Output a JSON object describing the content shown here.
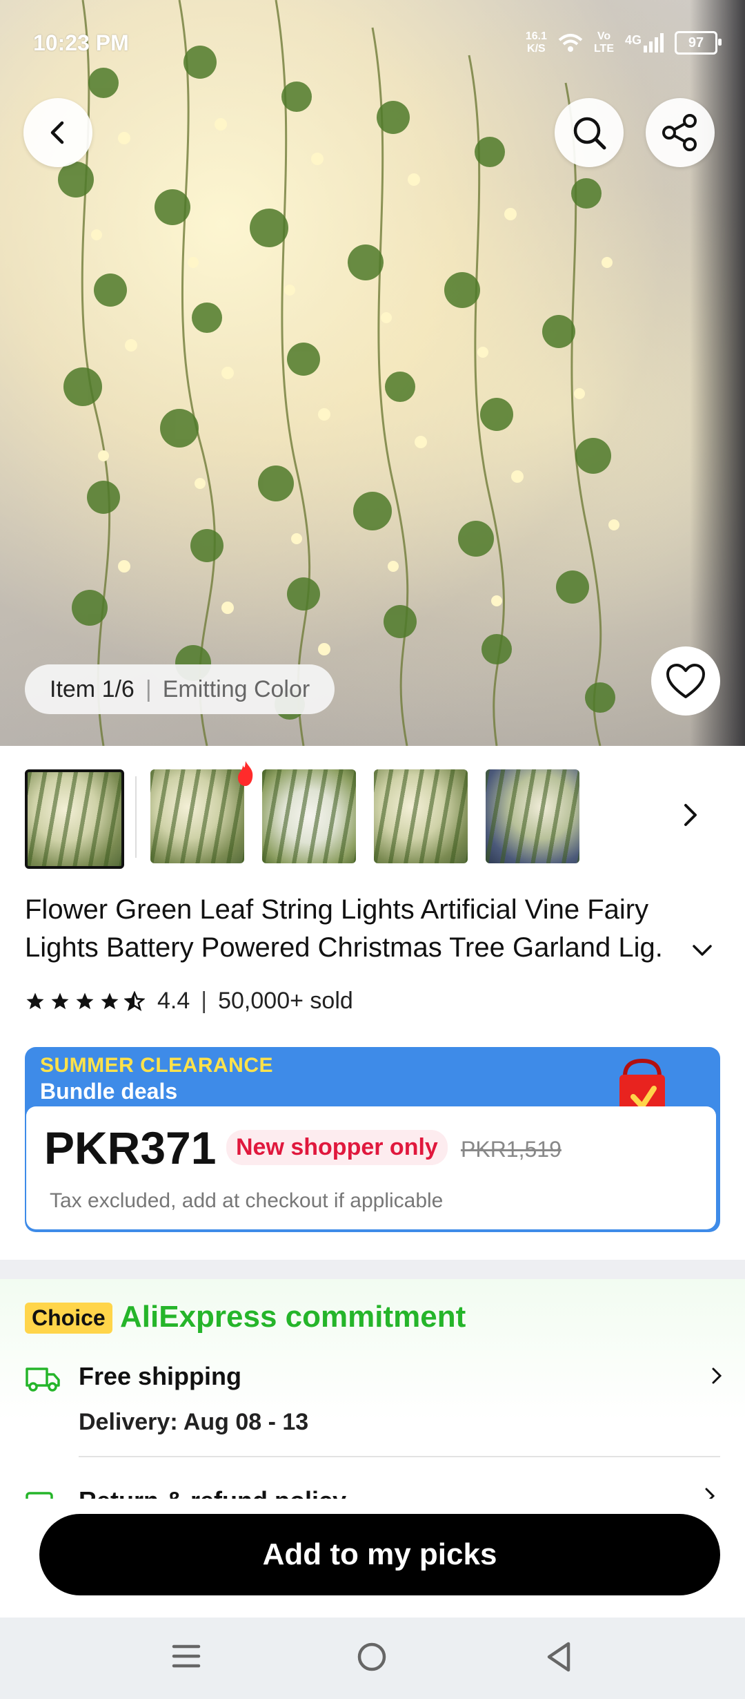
{
  "status_bar": {
    "time": "10:23 PM",
    "net_speed_value": "16.1",
    "net_speed_unit": "K/S",
    "volte_top": "Vo",
    "volte_bottom": "LTE",
    "network": "4G",
    "battery": "97"
  },
  "hero": {
    "item_counter": "Item 1/6",
    "variant": "Emitting Color"
  },
  "thumbnails": {
    "count": 5,
    "selected_index": 0
  },
  "product": {
    "title": "Flower Green Leaf String Lights Artificial Vine Fairy Lights Battery Powered Christmas Tree Garland Lig.",
    "rating": "4.4",
    "rating_value": 4.4,
    "sold": "50,000+ sold"
  },
  "deal": {
    "headline": "SUMMER CLEARANCE",
    "subheadline": "Bundle deals",
    "price": "PKR371",
    "badge": "New shopper only",
    "original_price": "PKR1,519",
    "tax_note": "Tax excluded, add at checkout if applicable"
  },
  "commitment": {
    "badge": "Choice",
    "title": "AliExpress commitment",
    "shipping_label": "Free shipping",
    "delivery": "Delivery: Aug 08 - 13",
    "returns_label": "Return & refund policy"
  },
  "cta": {
    "label": "Add to my picks"
  },
  "colors": {
    "accent_green": "#25b52a",
    "deal_blue": "#3e8be8",
    "promo_red": "#e0183d",
    "headline_yellow": "#ffe24a",
    "cta_black": "#000000"
  },
  "icons": [
    "back-arrow-icon",
    "search-icon",
    "share-icon",
    "heart-icon",
    "chevron-right-icon",
    "chevron-down-icon",
    "star-icon",
    "truck-icon",
    "fire-icon",
    "menu-icon",
    "home-icon",
    "back-nav-icon"
  ]
}
